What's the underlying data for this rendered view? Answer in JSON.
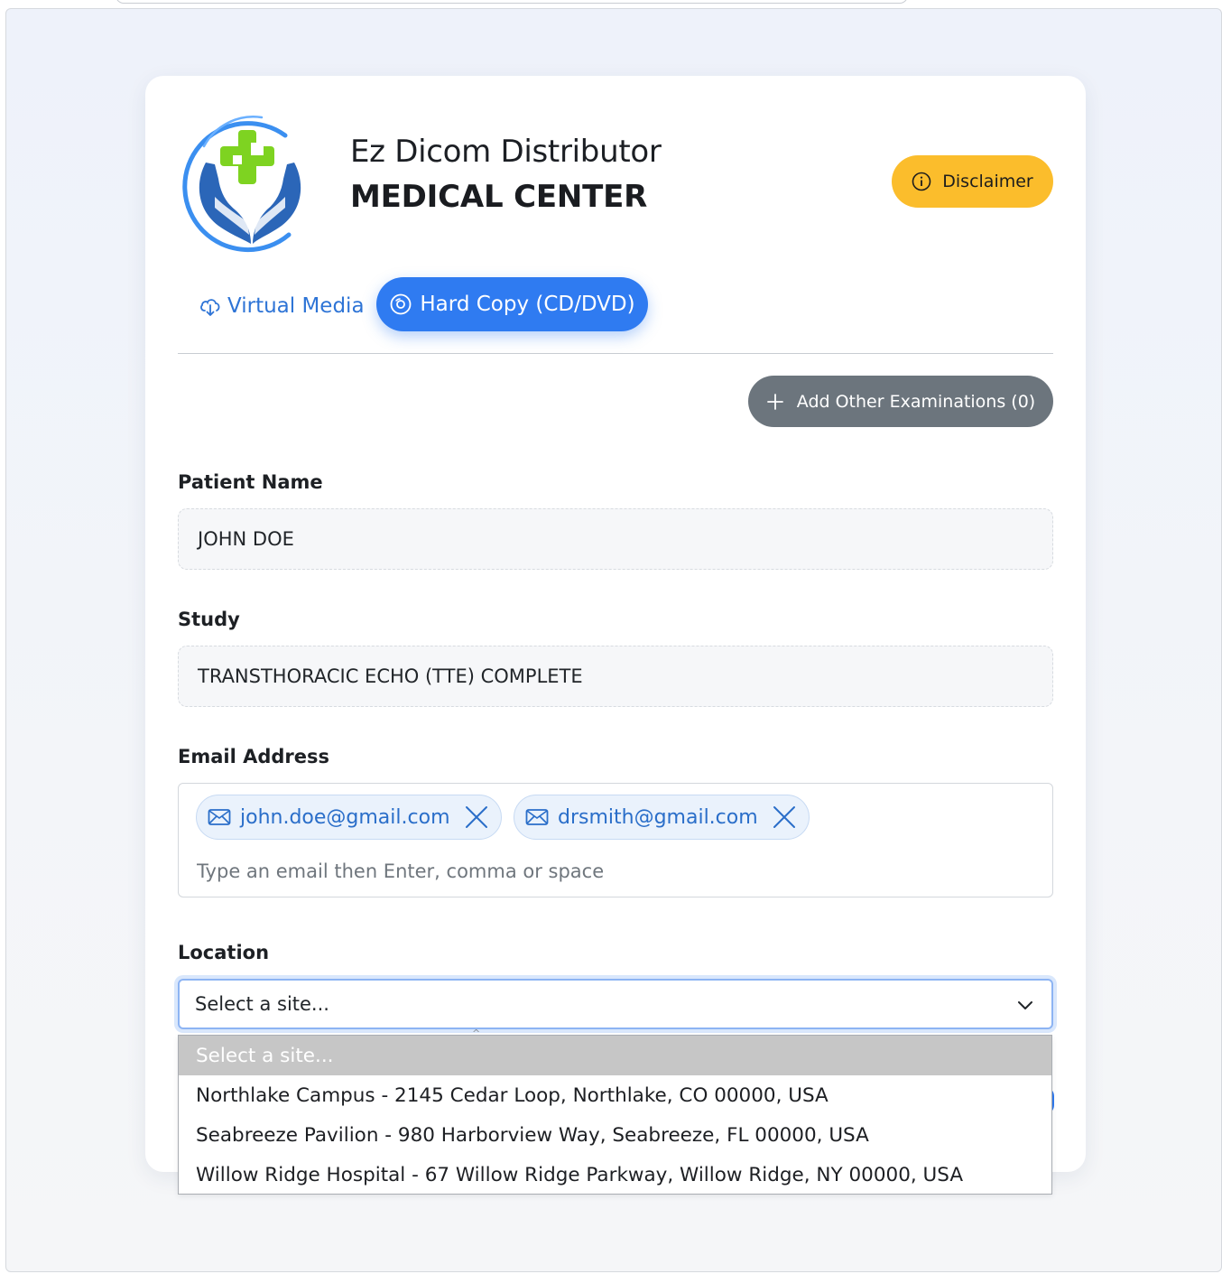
{
  "brand": {
    "name_line1": "Ez Dicom Distributor",
    "name_line2": "MEDICAL CENTER",
    "logo_icon": "medical-hands-cross-logo"
  },
  "header": {
    "disclaimer_label": "Disclaimer",
    "disclaimer_icon": "info-circle-icon"
  },
  "tabs": [
    {
      "label": "Virtual Media",
      "icon": "cloud-download-icon",
      "active": false
    },
    {
      "label": "Hard Copy (CD/DVD)",
      "icon": "disc-icon",
      "active": true
    }
  ],
  "actions": {
    "add_other_exams_label": "Add Other Examinations (0)",
    "add_icon": "plus-icon"
  },
  "form": {
    "patient_name": {
      "label": "Patient Name",
      "value": "JOHN DOE"
    },
    "study": {
      "label": "Study",
      "value": "TRANSTHORACIC ECHO (TTE) COMPLETE"
    },
    "email": {
      "label": "Email Address",
      "chips": [
        "john.doe@gmail.com",
        "drsmith@gmail.com"
      ],
      "placeholder": "Type an email then Enter, comma or space"
    },
    "location": {
      "label": "Location",
      "selected": "Select a site...",
      "options": [
        "Select a site...",
        "Northlake Campus - 2145 Cedar Loop, Northlake, CO 00000, USA",
        "Seabreeze Pavilion - 980 Harborview Way, Seabreeze, FL 00000, USA",
        "Willow Ridge Hospital - 67 Willow Ridge Parkway, Willow Ridge, NY 00000, USA"
      ]
    }
  },
  "colors": {
    "primary": "#2f7bf1",
    "warning": "#fbbd2c",
    "secondary": "#6c757d",
    "chip_bg": "#eaf2fc",
    "chip_text": "#2a6ec9",
    "logo_blue": "#2b66b8",
    "logo_green": "#7ed321"
  }
}
